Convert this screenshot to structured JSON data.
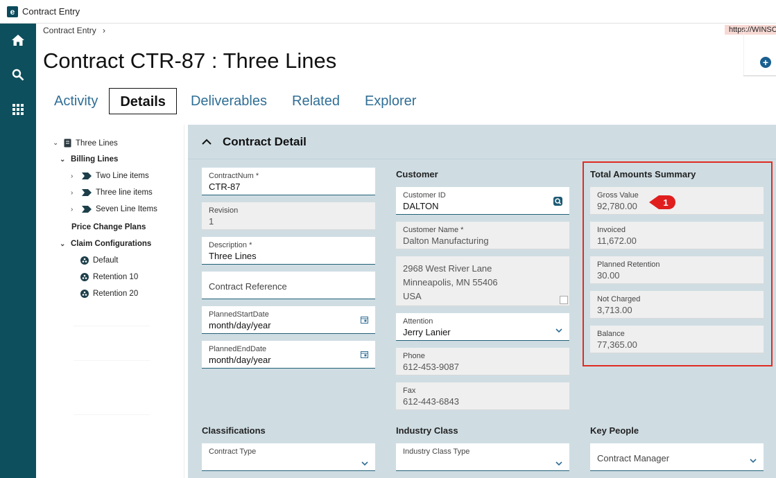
{
  "window": {
    "title": "Contract Entry",
    "url": "https://WINSC"
  },
  "breadcrumb": {
    "item": "Contract Entry",
    "sep": "›"
  },
  "page": {
    "title": "Contract CTR-87 : Three Lines"
  },
  "tabs": [
    {
      "label": "Activity"
    },
    {
      "label": "Details"
    },
    {
      "label": "Deliverables"
    },
    {
      "label": "Related"
    },
    {
      "label": "Explorer"
    }
  ],
  "tree": {
    "root": "Three Lines",
    "billing_lines": "Billing Lines",
    "billing_items": [
      "Two Line items",
      "Three line items",
      "Seven Line Items"
    ],
    "price_change_plans": "Price Change Plans",
    "claim_configurations": "Claim Configurations",
    "claim_items": [
      "Default",
      "Retention 10",
      "Retention 20"
    ]
  },
  "section": {
    "title": "Contract Detail"
  },
  "contract": {
    "contract_num_label": "ContractNum *",
    "contract_num": "CTR-87",
    "revision_label": "Revision",
    "revision": "1",
    "description_label": "Description *",
    "description": "Three Lines",
    "reference_placeholder": "Contract Reference",
    "start_label": "PlannedStartDate",
    "start_value": "month/day/year",
    "end_label": "PlannedEndDate",
    "end_value": "month/day/year"
  },
  "customer": {
    "heading": "Customer",
    "id_label": "Customer ID",
    "id": "DALTON",
    "name_label": "Customer Name *",
    "name": "Dalton Manufacturing",
    "address_lines": [
      "2968 West River Lane",
      "Minneapolis, MN  55406",
      "USA"
    ],
    "attention_label": "Attention",
    "attention": "Jerry Lanier",
    "phone_label": "Phone",
    "phone": "612-453-9087",
    "fax_label": "Fax",
    "fax": "612-443-6843"
  },
  "summary": {
    "heading": "Total Amounts Summary",
    "items": [
      {
        "label": "Gross Value",
        "value": "92,780.00"
      },
      {
        "label": "Invoiced",
        "value": "11,672.00"
      },
      {
        "label": "Planned Retention",
        "value": "30.00"
      },
      {
        "label": "Not Charged",
        "value": "3,713.00"
      },
      {
        "label": "Balance",
        "value": "77,365.00"
      }
    ],
    "badge": "1",
    "highlight_color": "#e02b20"
  },
  "classifications": {
    "heading": "Classifications",
    "contract_type_label": "Contract Type"
  },
  "industry": {
    "heading": "Industry Class",
    "type_label": "Industry Class Type"
  },
  "key_people": {
    "heading": "Key People",
    "manager_placeholder": "Contract Manager"
  },
  "colors": {
    "nav": "#0d4f5c",
    "accent": "#2f6e95",
    "panel": "#cfdde3"
  }
}
